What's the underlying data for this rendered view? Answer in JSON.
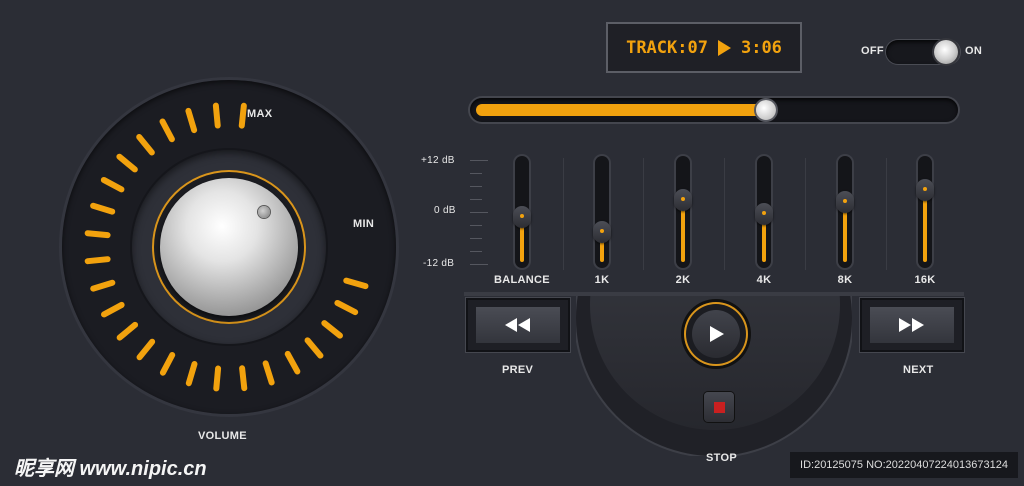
{
  "volume": {
    "label": "VOLUME",
    "max_label": "MAX",
    "min_label": "MIN"
  },
  "display": {
    "track": "TRACK:07",
    "time": "3:06",
    "play_icon": "play-icon"
  },
  "power_toggle": {
    "off_label": "OFF",
    "on_label": "ON",
    "state": "on"
  },
  "progress": {
    "value": 0.61
  },
  "equalizer": {
    "scale": {
      "top": "+12 dB",
      "mid": "0 dB",
      "bottom": "-12 dB"
    },
    "bands": [
      {
        "label": "BALANCE",
        "level": 0.45
      },
      {
        "label": "1K",
        "level": 0.3
      },
      {
        "label": "2K",
        "level": 0.62
      },
      {
        "label": "4K",
        "level": 0.48
      },
      {
        "label": "8K",
        "level": 0.6
      },
      {
        "label": "16K",
        "level": 0.72
      }
    ]
  },
  "transport": {
    "prev_label": "PREV",
    "next_label": "NEXT",
    "stop_label": "STOP",
    "prev_icon": "rewind-icon",
    "next_icon": "fast-forward-icon",
    "play_icon": "play-icon",
    "stop_icon": "stop-icon"
  },
  "colors": {
    "accent": "#f2a20e",
    "background": "#2b2d35",
    "stop": "#c92020"
  },
  "watermark": {
    "left": "昵享网 www.nipic.cn",
    "right": "ID:20125075 NO:20220407224013673124"
  }
}
